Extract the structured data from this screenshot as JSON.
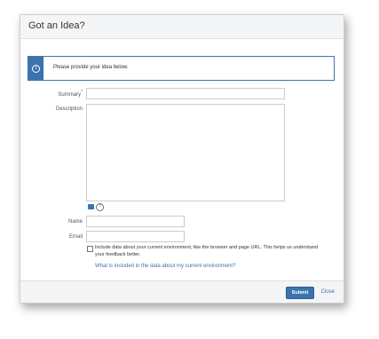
{
  "dialog": {
    "title": "Got an Idea?",
    "info_message": "Please provide your idea below.",
    "info_icon": "info-icon"
  },
  "form": {
    "summary": {
      "label": "Summary",
      "required_mark": "*",
      "value": ""
    },
    "description": {
      "label": "Description",
      "value": ""
    },
    "editor_icons": [
      "wiki-markup-icon",
      "help-icon"
    ],
    "help_glyph": "?",
    "name": {
      "label": "Name",
      "value": ""
    },
    "email": {
      "label": "Email",
      "value": ""
    },
    "include_env": {
      "checked": false,
      "text": "Include data about your current environment, like the browser and page URL. This helps us understand your feedback better."
    },
    "env_link": "What is included in the data about my current environment?"
  },
  "footer": {
    "submit_label": "Submit",
    "close_label": "Close"
  },
  "colors": {
    "accent": "#3b73af",
    "header_bg": "#f4f5f7",
    "required": "#d04437"
  }
}
